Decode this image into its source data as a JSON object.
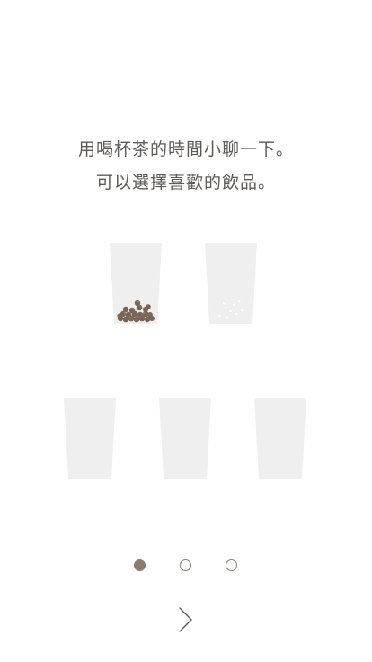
{
  "intro": {
    "line1": "用喝杯茶的時間小聊一下。",
    "line2": "可以選擇喜歡的飲品。"
  },
  "cups": [
    {
      "name": "pearl-tea-cup",
      "topping": "pearls"
    },
    {
      "name": "jelly-tea-cup",
      "topping": "crystals"
    },
    {
      "name": "cup-3",
      "topping": "none"
    },
    {
      "name": "cup-4",
      "topping": "none"
    },
    {
      "name": "cup-5",
      "topping": "none"
    }
  ],
  "pagination": {
    "total": 3,
    "current": 1
  },
  "icons": {
    "next": "chevron-right-icon"
  },
  "colors": {
    "text": "#5e5a57",
    "cup": "#efefef",
    "pearl": "#7a6556",
    "dot": "#8a7c72",
    "background": "#ffffff"
  }
}
